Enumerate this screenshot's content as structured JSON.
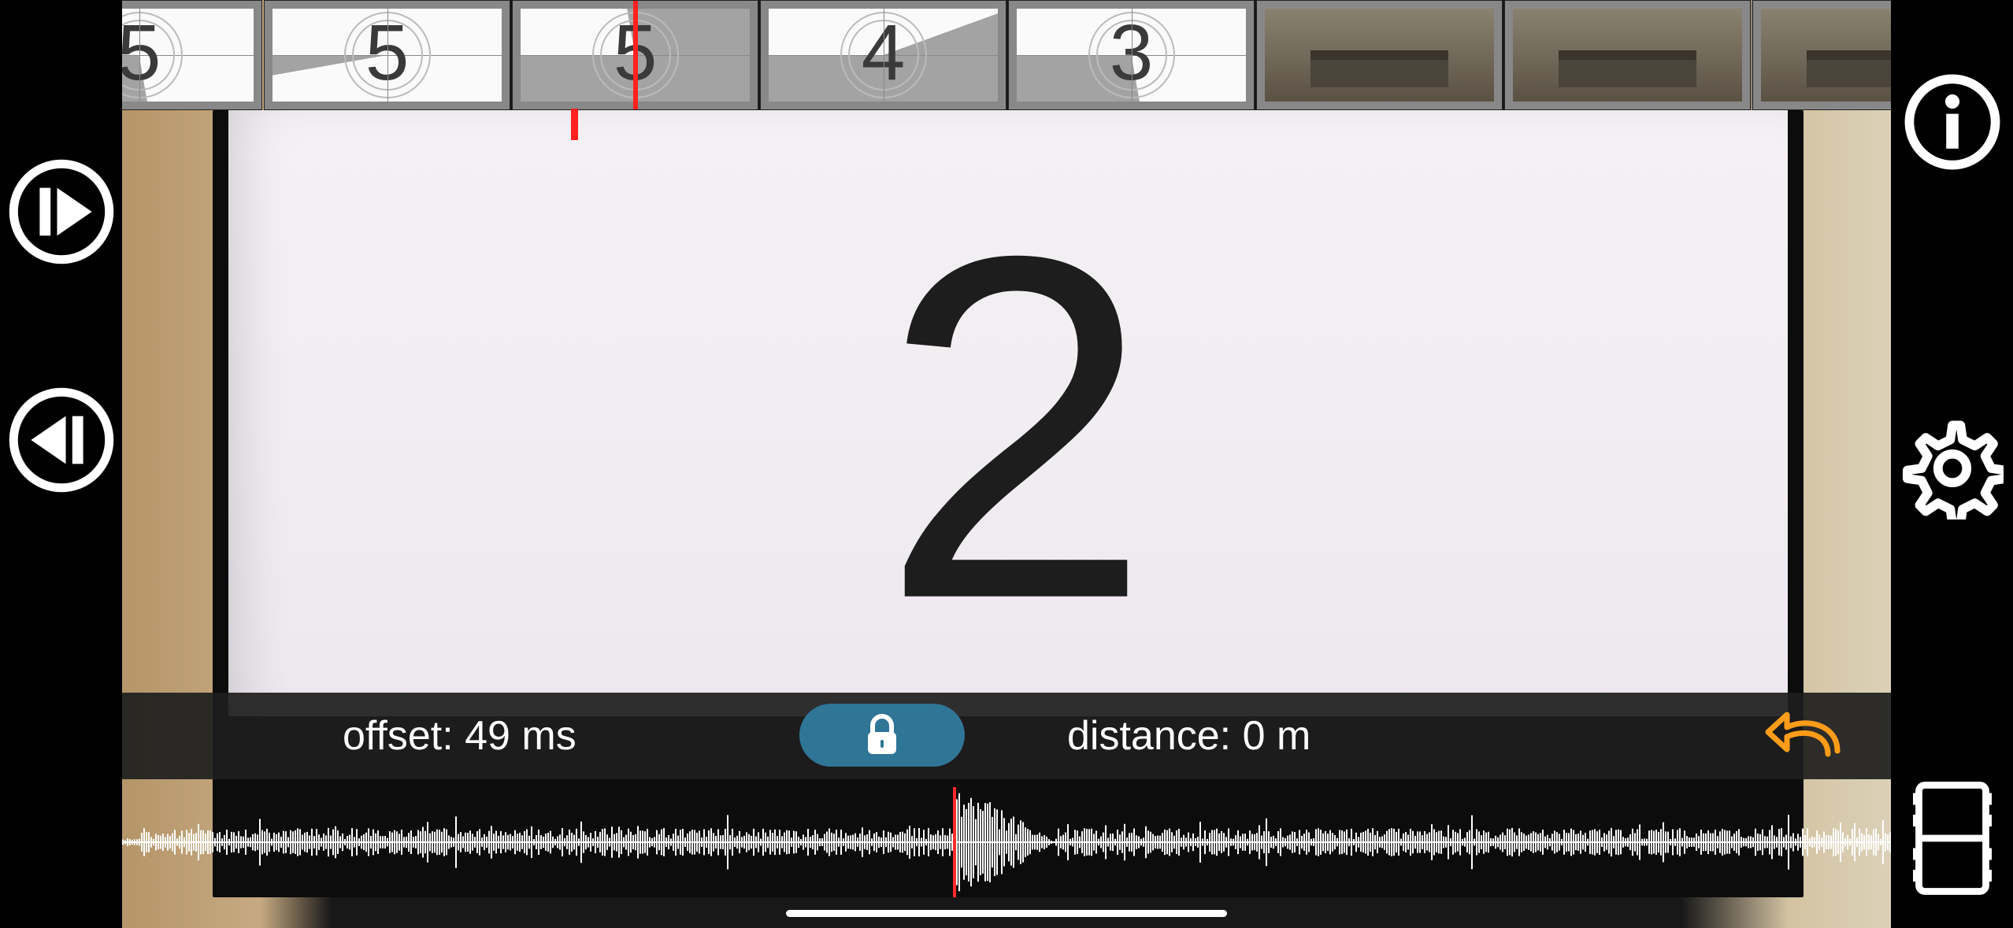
{
  "thumbnails": [
    {
      "type": "leader",
      "number": "5",
      "sweep": "deg260"
    },
    {
      "type": "leader",
      "number": "5",
      "sweep": "deg350"
    },
    {
      "type": "leader",
      "number": "5",
      "sweep": "deg80",
      "is_playhead": true
    },
    {
      "type": "leader",
      "number": "4",
      "sweep": "deg160"
    },
    {
      "type": "leader",
      "number": "3",
      "sweep": "deg260"
    },
    {
      "type": "scene"
    },
    {
      "type": "scene"
    },
    {
      "type": "scene"
    }
  ],
  "preview": {
    "big_number": "2"
  },
  "info_bar": {
    "offset_label": "offset: 49 ms",
    "distance_label": "distance: 0 m"
  },
  "icons": {
    "step_forward": "step-forward-icon",
    "step_back": "step-back-icon",
    "info": "info-icon",
    "settings": "gear-icon",
    "filmstrip": "filmstrip-icon",
    "lock": "lock-icon",
    "undo": "undo-icon"
  },
  "colors": {
    "accent_pill": "#2f7596",
    "undo": "#ff9c1a",
    "playhead": "#ff2020"
  }
}
